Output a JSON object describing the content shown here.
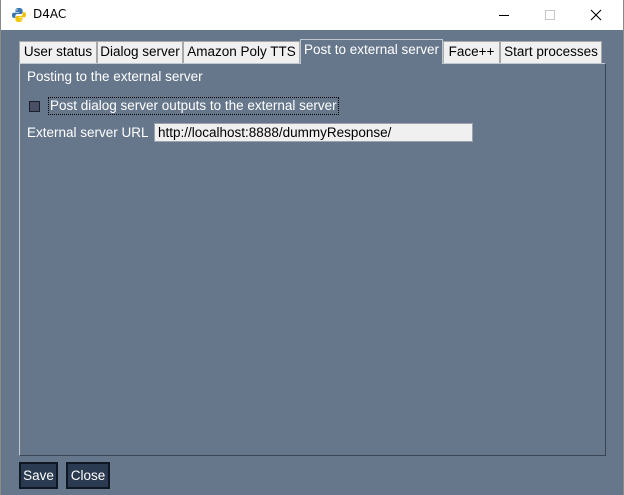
{
  "window": {
    "title": "D4AC"
  },
  "titlebar": {
    "minimize_icon": "minimize-icon",
    "maximize_icon": "maximize-icon",
    "close_icon": "close-icon"
  },
  "tabs": [
    {
      "label": "User status",
      "active": false
    },
    {
      "label": "Dialog server",
      "active": false
    },
    {
      "label": "Amazon Poly TTS",
      "active": false
    },
    {
      "label": "Post to external server",
      "active": true
    },
    {
      "label": "Face++",
      "active": false
    },
    {
      "label": "Start processes",
      "active": false
    }
  ],
  "panel": {
    "section_title": "Posting to the external server",
    "checkbox_label": "Post dialog server outputs to the external server",
    "checkbox_checked": false,
    "url_label": "External server URL",
    "url_value": "http://localhost:8888/dummyResponse/"
  },
  "buttons": {
    "save_label": "Save",
    "close_label": "Close"
  },
  "colors": {
    "background": "#66778c",
    "button": "#2a3a50",
    "tab_inactive": "#f0f0f0"
  }
}
